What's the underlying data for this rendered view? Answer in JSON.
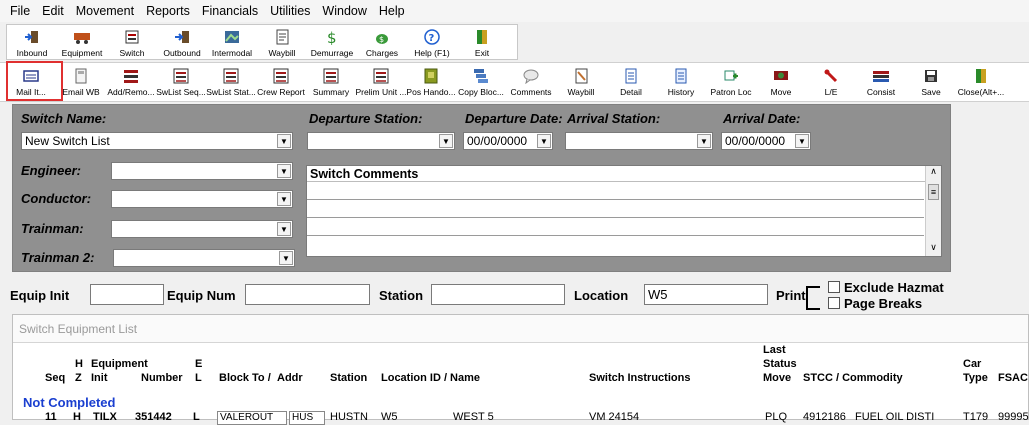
{
  "menu": [
    "File",
    "Edit",
    "Movement",
    "Reports",
    "Financials",
    "Utilities",
    "Window",
    "Help"
  ],
  "toolbar1": [
    {
      "label": "Inbound",
      "icon": "inbound-icon"
    },
    {
      "label": "Equipment",
      "icon": "equipment-icon"
    },
    {
      "label": "Switch",
      "icon": "switch-icon"
    },
    {
      "label": "Outbound",
      "icon": "outbound-icon"
    },
    {
      "label": "Intermodal",
      "icon": "intermodal-icon"
    },
    {
      "label": "Waybill",
      "icon": "waybill-icon"
    },
    {
      "label": "Demurrage",
      "icon": "demurrage-icon"
    },
    {
      "label": "Charges",
      "icon": "charges-icon"
    },
    {
      "label": "Help (F1)",
      "icon": "help-icon"
    },
    {
      "label": "Exit",
      "icon": "exit-icon"
    }
  ],
  "toolbar2": [
    {
      "label": "Mail It...",
      "icon": "mail-icon"
    },
    {
      "label": "Email WB",
      "icon": "email-icon"
    },
    {
      "label": "Add/Remo...",
      "icon": "add-remove-icon"
    },
    {
      "label": "SwList Seq...",
      "icon": "list-sequence-icon"
    },
    {
      "label": "SwList Stat...",
      "icon": "list-status-icon"
    },
    {
      "label": "Crew Report",
      "icon": "crew-report-icon"
    },
    {
      "label": "Summary",
      "icon": "summary-icon"
    },
    {
      "label": "Prelim Unit ...",
      "icon": "prelim-unit-icon"
    },
    {
      "label": "Pos Hando...",
      "icon": "handout-icon"
    },
    {
      "label": "Copy Bloc...",
      "icon": "copy-block-icon"
    },
    {
      "label": "Comments",
      "icon": "comments-icon"
    },
    {
      "label": "Waybill",
      "icon": "waybill-icon"
    },
    {
      "label": "Detail",
      "icon": "detail-icon"
    },
    {
      "label": "History",
      "icon": "history-icon"
    },
    {
      "label": "Patron Loc",
      "icon": "patron-loc-icon"
    },
    {
      "label": "Move",
      "icon": "move-icon"
    },
    {
      "label": "L/E",
      "icon": "load-empty-icon"
    },
    {
      "label": "Consist",
      "icon": "consist-icon"
    },
    {
      "label": "Save",
      "icon": "save-icon"
    },
    {
      "label": "Close(Alt+...",
      "icon": "close-icon"
    }
  ],
  "form": {
    "switch_name_label": "Switch Name:",
    "switch_name_value": "New Switch List",
    "departure_station_label": "Departure Station:",
    "departure_date_label": "Departure Date:",
    "departure_date_value": "00/00/0000",
    "arrival_station_label": "Arrival Station:",
    "arrival_date_label": "Arrival Date:",
    "arrival_date_value": "00/00/0000",
    "engineer_label": "Engineer:",
    "conductor_label": "Conductor:",
    "trainman_label": "Trainman:",
    "trainman2_label": "Trainman 2:",
    "comments_label": "Switch Comments"
  },
  "filters": {
    "equip_init_label": "Equip Init",
    "equip_num_label": "Equip Num",
    "station_label": "Station",
    "location_label": "Location",
    "location_value": "W5",
    "print_label": "Print",
    "exclude_hazmat_label": "Exclude Hazmat",
    "page_breaks_label": "Page Breaks"
  },
  "list": {
    "title": "Switch Equipment List",
    "columns": {
      "seq": "Seq",
      "hz": "H\nZ",
      "equip_init": "Equipment\nInit",
      "number": "Number",
      "el": "E\nL",
      "block_to": "Block To /",
      "addr": "Addr",
      "station": "Station",
      "location": "Location ID / Name",
      "instructions": "Switch Instructions",
      "last_status": "Last\nStatus\nMove",
      "stcc": "STCC / Commodity",
      "car_type": "Car\nType",
      "fsac": "FSAC"
    },
    "section": "Not Completed",
    "row": {
      "seq": "11",
      "hz": "H",
      "init": "TILX",
      "number": "351442",
      "el": "L",
      "block_to": "VALEROUT",
      "addr": "HUS",
      "station": "HUSTN",
      "loc_id": "W5",
      "loc_name": "WEST 5",
      "instructions": "VM 24154",
      "last_move": "PLQ",
      "stcc": "4912186",
      "commodity": "FUEL OIL DISTI",
      "car_type": "T179",
      "fsac": "99995"
    }
  }
}
